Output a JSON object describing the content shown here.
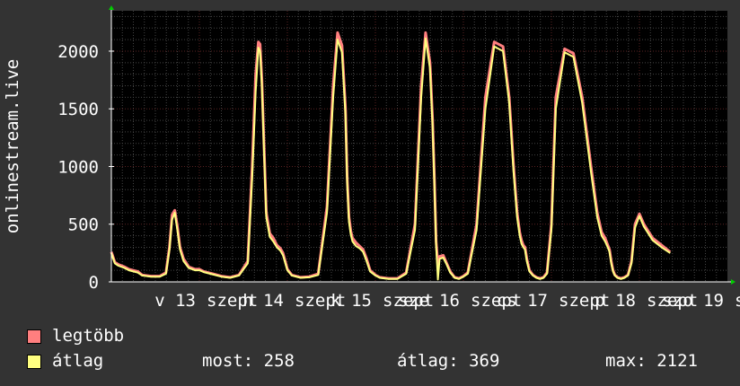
{
  "chart_data": {
    "type": "line",
    "ylabel": "onlinestream.live",
    "ylim": [
      0,
      2350
    ],
    "yticks": [
      0,
      500,
      1000,
      1500,
      2000
    ],
    "x_tick_labels": [
      "v 13",
      "szept",
      "h 14",
      "szept",
      "k 15",
      "szept",
      "sze 16",
      "szept",
      "cs 17",
      "szept",
      "p 18",
      "szept",
      "szo 19",
      "s"
    ],
    "grid": true,
    "series": [
      {
        "name": "legtöbb",
        "color": "#ff7f7f",
        "t": [
          0,
          0.04,
          0.08,
          0.15,
          0.2,
          0.3,
          0.35,
          0.45,
          0.55,
          0.62,
          0.66,
          0.69,
          0.72,
          0.75,
          0.78,
          0.82,
          0.88,
          0.95,
          1.0,
          1.05,
          1.15,
          1.25,
          1.35,
          1.45,
          1.55,
          1.6,
          1.64,
          1.67,
          1.69,
          1.71,
          1.73,
          1.76,
          1.8,
          1.84,
          1.88,
          1.92,
          1.95,
          2.0,
          2.05,
          2.15,
          2.25,
          2.35,
          2.45,
          2.52,
          2.57,
          2.62,
          2.66,
          2.68,
          2.7,
          2.72,
          2.74,
          2.78,
          2.82,
          2.86,
          2.9,
          2.94,
          3.0,
          3.05,
          3.15,
          3.25,
          3.35,
          3.45,
          3.52,
          3.57,
          3.62,
          3.65,
          3.67,
          3.69,
          3.71,
          3.73,
          3.77,
          3.81,
          3.85,
          3.88,
          3.9,
          3.95,
          4.0,
          4.05,
          4.15,
          4.25,
          4.35,
          4.45,
          4.52,
          4.57,
          4.61,
          4.64,
          4.66,
          4.68,
          4.7,
          4.72,
          4.75,
          4.79,
          4.83,
          4.87,
          4.91,
          4.95,
          5.0,
          5.05,
          5.15,
          5.25,
          5.35,
          5.45,
          5.52,
          5.57,
          5.61,
          5.64,
          5.66,
          5.68,
          5.7,
          5.72,
          5.75,
          5.79,
          5.83,
          5.87,
          5.91,
          5.95,
          6.0,
          6.05,
          6.15,
          6.25,
          6.35,
          6.45,
          6.52,
          6.58,
          6.62,
          6.65,
          6.68,
          6.72,
          6.76,
          6.8,
          6.84
        ],
        "values": [
          260,
          170,
          150,
          130,
          110,
          90,
          60,
          50,
          50,
          80,
          300,
          580,
          620,
          480,
          300,
          200,
          130,
          110,
          110,
          90,
          70,
          50,
          40,
          60,
          180,
          1000,
          1800,
          2080,
          2060,
          1750,
          1300,
          600,
          420,
          380,
          320,
          290,
          250,
          110,
          60,
          40,
          45,
          70,
          650,
          1700,
          2160,
          2050,
          1500,
          900,
          560,
          440,
          380,
          340,
          310,
          280,
          200,
          100,
          60,
          40,
          30,
          30,
          80,
          500,
          1700,
          2160,
          1900,
          1400,
          900,
          350,
          150,
          220,
          230,
          160,
          90,
          60,
          40,
          30,
          50,
          80,
          500,
          1600,
          2080,
          2040,
          1600,
          1000,
          600,
          430,
          360,
          320,
          300,
          200,
          100,
          60,
          40,
          30,
          40,
          80,
          500,
          1600,
          2020,
          1980,
          1600,
          1000,
          600,
          430,
          380,
          320,
          280,
          180,
          100,
          60,
          40,
          30,
          40,
          60,
          180,
          500,
          590,
          500,
          380,
          320,
          258
        ]
      },
      {
        "name": "átlag",
        "color": "#ffff80",
        "t": [
          0,
          0.04,
          0.08,
          0.15,
          0.2,
          0.3,
          0.35,
          0.45,
          0.55,
          0.62,
          0.66,
          0.69,
          0.72,
          0.75,
          0.78,
          0.82,
          0.88,
          0.95,
          1.0,
          1.05,
          1.15,
          1.25,
          1.35,
          1.45,
          1.55,
          1.6,
          1.64,
          1.67,
          1.69,
          1.71,
          1.73,
          1.76,
          1.8,
          1.84,
          1.88,
          1.92,
          1.95,
          2.0,
          2.05,
          2.15,
          2.25,
          2.35,
          2.45,
          2.52,
          2.57,
          2.62,
          2.66,
          2.68,
          2.7,
          2.72,
          2.74,
          2.78,
          2.82,
          2.86,
          2.9,
          2.94,
          3.0,
          3.05,
          3.15,
          3.25,
          3.35,
          3.45,
          3.52,
          3.57,
          3.62,
          3.65,
          3.67,
          3.69,
          3.71,
          3.73,
          3.77,
          3.81,
          3.85,
          3.88,
          3.9,
          3.95,
          4.0,
          4.05,
          4.15,
          4.25,
          4.35,
          4.45,
          4.52,
          4.57,
          4.61,
          4.64,
          4.66,
          4.68,
          4.7,
          4.72,
          4.75,
          4.79,
          4.83,
          4.87,
          4.91,
          4.95,
          5.0,
          5.05,
          5.15,
          5.25,
          5.35,
          5.45,
          5.52,
          5.57,
          5.61,
          5.64,
          5.66,
          5.68,
          5.7,
          5.72,
          5.75,
          5.79,
          5.83,
          5.87,
          5.91,
          5.95,
          6.0,
          6.05,
          6.15,
          6.25,
          6.35,
          6.45,
          6.52,
          6.58,
          6.62,
          6.65,
          6.68,
          6.72,
          6.76,
          6.8,
          6.84
        ],
        "values": [
          250,
          160,
          140,
          120,
          100,
          80,
          55,
          45,
          45,
          70,
          280,
          540,
          600,
          450,
          280,
          180,
          120,
          100,
          100,
          85,
          65,
          45,
          35,
          55,
          160,
          900,
          1650,
          2030,
          2000,
          1700,
          1250,
          560,
          390,
          350,
          300,
          270,
          230,
          100,
          55,
          35,
          40,
          60,
          600,
          1600,
          2100,
          1990,
          1450,
          860,
          520,
          410,
          350,
          310,
          290,
          260,
          180,
          90,
          55,
          35,
          25,
          25,
          70,
          450,
          1600,
          2110,
          1850,
          1350,
          850,
          320,
          20,
          200,
          210,
          150,
          80,
          55,
          35,
          25,
          45,
          70,
          450,
          1500,
          2040,
          2000,
          1550,
          950,
          560,
          400,
          330,
          300,
          280,
          180,
          90,
          55,
          35,
          25,
          35,
          70,
          450,
          1500,
          1990,
          1950,
          1550,
          950,
          560,
          400,
          350,
          300,
          260,
          160,
          90,
          55,
          35,
          25,
          35,
          55,
          160,
          470,
          570,
          480,
          360,
          300,
          250
        ]
      }
    ],
    "stats": {
      "current_label": "most:",
      "current_value": "258",
      "average_label": "átlag:",
      "average_value": "369",
      "max_label": "max:",
      "max_value": "2121"
    }
  },
  "colors": {
    "background": "#333333",
    "plot_background": "#000000",
    "grid_major": "#5a2222",
    "grid_minor": "#444444",
    "axis": "#ffffff",
    "arrow": "#00cc00"
  }
}
